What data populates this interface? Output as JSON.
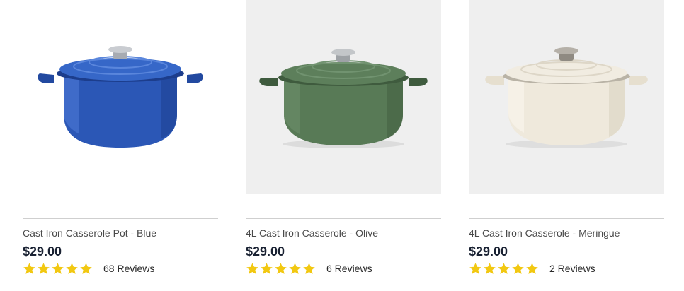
{
  "products": [
    {
      "name": "Cast Iron Casserole Pot - Blue",
      "price": "$29.00",
      "rating": 5,
      "reviews": "68 Reviews",
      "image": "blue-casserole-pot",
      "colors": {
        "body": "#2b57b6",
        "dark": "#1c3d8c",
        "light": "#4c78d6",
        "knob": "#b9bcc2",
        "background": "#ffffff"
      }
    },
    {
      "name": "4L Cast Iron Casserole - Olive",
      "price": "$29.00",
      "rating": 5,
      "reviews": "6 Reviews",
      "image": "olive-casserole-pot",
      "colors": {
        "body": "#587a56",
        "dark": "#3f5b3e",
        "light": "#6d8e6b",
        "knob": "#b4b7ba",
        "background": "#efefef"
      }
    },
    {
      "name": "4L Cast Iron Casserole - Meringue",
      "price": "$29.00",
      "rating": 5,
      "reviews": "2 Reviews",
      "image": "meringue-casserole-pot",
      "colors": {
        "body": "#efe9dc",
        "dark": "#ddd5c4",
        "light": "#f7f3ea",
        "knob": "#a8a39a",
        "background": "#efefef"
      }
    }
  ],
  "theme": {
    "star_color": "#f2c811",
    "price_color": "#1a2233",
    "divider_color": "#cfcfcf"
  }
}
